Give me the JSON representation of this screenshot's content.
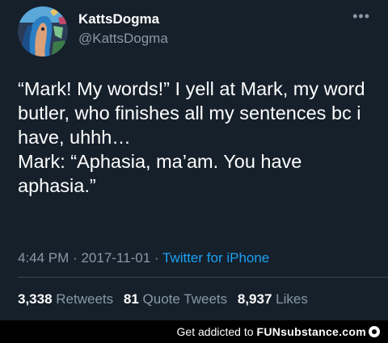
{
  "tweet": {
    "display_name": "KattsDogma",
    "handle": "@KattsDogma",
    "more_icon": "•••",
    "text": "“Mark! My words!” I yell at Mark, my word butler, who finishes all my sentences bc i have, uhhh…\nMark: “Aphasia, ma’am. You have aphasia.”",
    "time": "4:44 PM",
    "separator": "·",
    "date": "2017-11-01",
    "source": "Twitter for iPhone"
  },
  "stats": {
    "retweets_count": "3,338",
    "retweets_label": "Retweets",
    "quotes_count": "81",
    "quotes_label": "Quote Tweets",
    "likes_count": "8,937",
    "likes_label": "Likes"
  },
  "footer": {
    "text": "Get addicted to",
    "brand": "FUNsubstance.com"
  },
  "colors": {
    "background": "#15202b",
    "secondary_text": "#8899a6",
    "link": "#1da1f2",
    "divider": "#38444d"
  }
}
